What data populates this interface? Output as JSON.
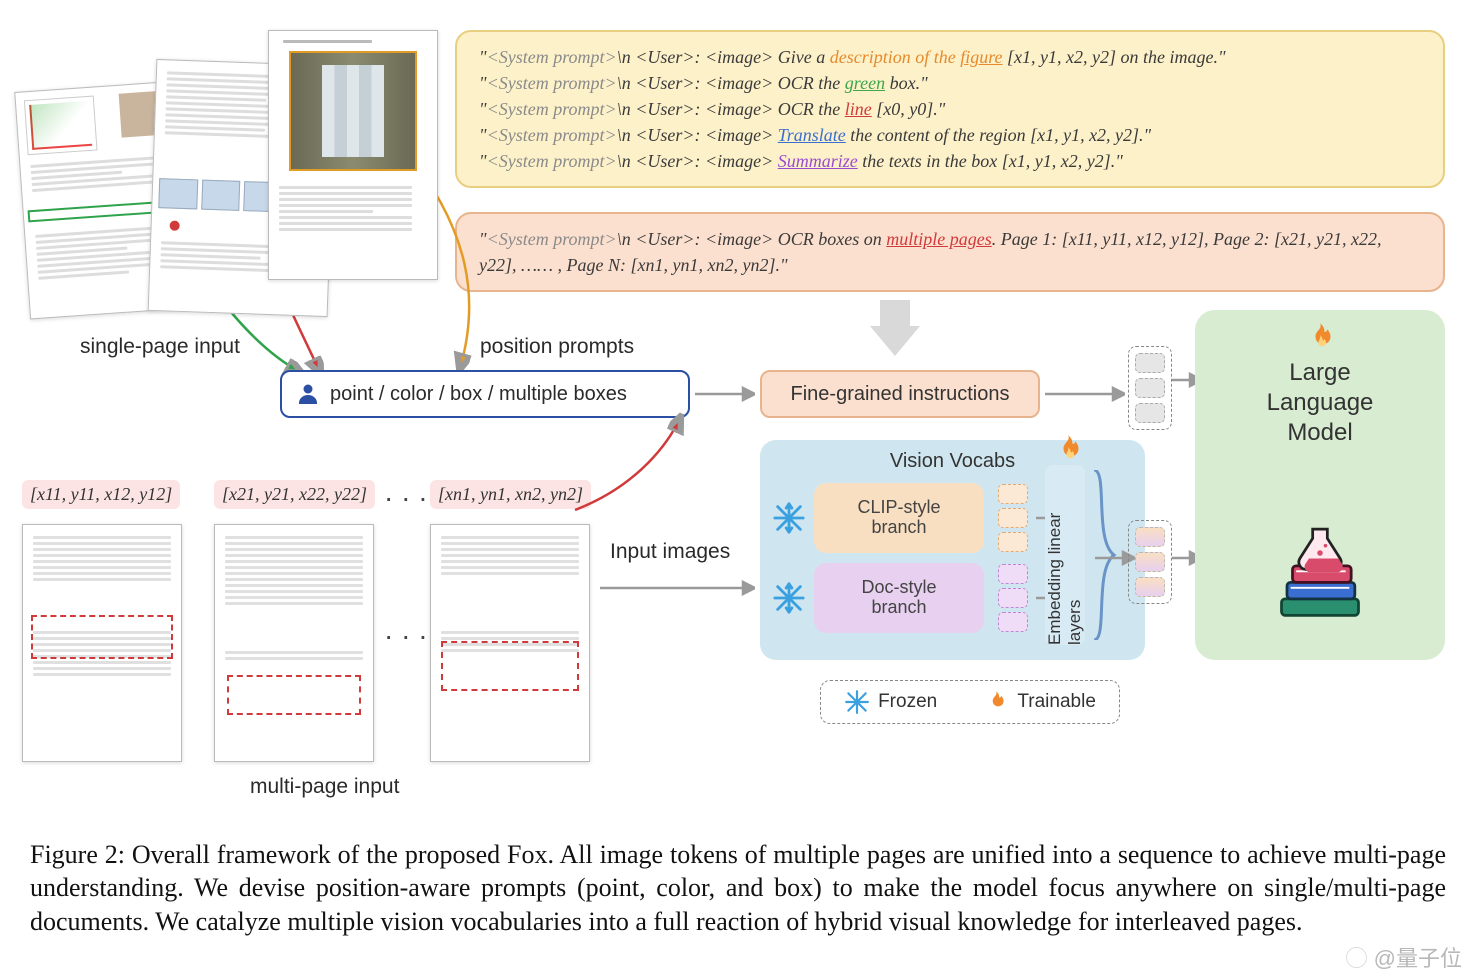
{
  "caption": "Figure 2: Overall framework of the proposed Fox. All image tokens of multiple pages are unified into a sequence to achieve multi-page understanding. We devise position-aware prompts (point, color, and box) to make the model focus anywhere on single/multi-page documents. We catalyze multiple vision vocabularies into a full reaction of hybrid visual knowledge for interleaved pages.",
  "prompts_single": [
    {
      "pre": "\"<System prompt>\\n <User>: <image> Give a ",
      "kw": "description of the",
      "kwClass": "kw-orange-plain",
      "kw2": "figure",
      "kw2Class": "kw-orange",
      "post": " [x1, y1, x2, y2] on the image.\""
    },
    {
      "pre": "\"<System prompt>\\n <User>: <image> OCR the ",
      "kw": "green",
      "kwClass": "kw-green",
      "post": " box.\""
    },
    {
      "pre": "\"<System prompt>\\n <User>: <image> OCR the ",
      "kw": "line",
      "kwClass": "kw-red",
      "post": " [x0, y0].\""
    },
    {
      "pre": "\"<System prompt>\\n <User>: <image> ",
      "kw": "Translate",
      "kwClass": "kw-blue",
      "post": " the content of the region [x1, y1, x2, y2].\""
    },
    {
      "pre": "\"<System prompt>\\n <User>: <image> ",
      "kw": "Summarize",
      "kwClass": "kw-purple",
      "post": " the texts in the box [x1, y1, x2, y2].\""
    }
  ],
  "prompt_multi": {
    "pre": "\"<System prompt>\\n <User>: <image> OCR boxes on ",
    "kw": "multiple pages",
    "post": ". Page 1: [x11, y11, x12, y12], Page 2: [x21, y21, x22, y22], …… , Page N: [xn1, yn1, xn2, yn2].\""
  },
  "labels": {
    "single_page": "single-page input",
    "position_prompts": "position prompts",
    "multi_page": "multi-page input",
    "input_images": "Input images",
    "vision_vocabs": "Vision Vocabs",
    "clip_branch_l1": "CLIP-style",
    "clip_branch_l2": "branch",
    "doc_branch_l1": "Doc-style",
    "doc_branch_l2": "branch",
    "embedding": "Embedding linear layers",
    "llm_l1": "Large",
    "llm_l2": "Language",
    "llm_l3": "Model",
    "fine_grained": "Fine-grained instructions",
    "pos_box": "point / color / box / multiple boxes"
  },
  "mp_coords": [
    "[x11, y11, x12, y12]",
    "[x21, y21, x22, y22]",
    "[xn1, yn1, xn2, yn2]"
  ],
  "legend": {
    "frozen": "Frozen",
    "trainable": "Trainable"
  },
  "watermark": "@量子位"
}
